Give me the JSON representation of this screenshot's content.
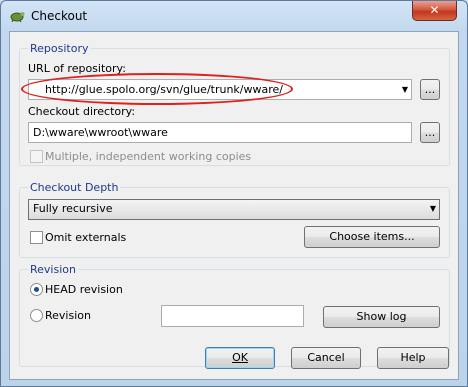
{
  "window": {
    "title": "Checkout",
    "close_label": "✕",
    "app_icon": "tortoise-icon"
  },
  "repository": {
    "group_title": "Repository",
    "url_label": "URL of repository:",
    "url_value": "http://glue.spolo.org/svn/glue/trunk/wware/",
    "url_browse_label": "...",
    "dir_label": "Checkout directory:",
    "dir_value": "D:\\wware\\wwroot\\wware",
    "dir_browse_label": "...",
    "multiple_label": "Multiple, independent working copies"
  },
  "depth": {
    "group_title": "Checkout Depth",
    "selected": "Fully recursive",
    "omit_label": "Omit externals",
    "choose_items_label": "Choose items..."
  },
  "revision": {
    "group_title": "Revision",
    "head_label": "HEAD revision",
    "revision_label": "Revision",
    "revision_value": "",
    "show_log_label": "Show log"
  },
  "buttons": {
    "ok": "OK",
    "cancel": "Cancel",
    "help": "Help"
  },
  "colors": {
    "annotation_ellipse": "#e0201c",
    "group_title": "#1e3a8a"
  }
}
